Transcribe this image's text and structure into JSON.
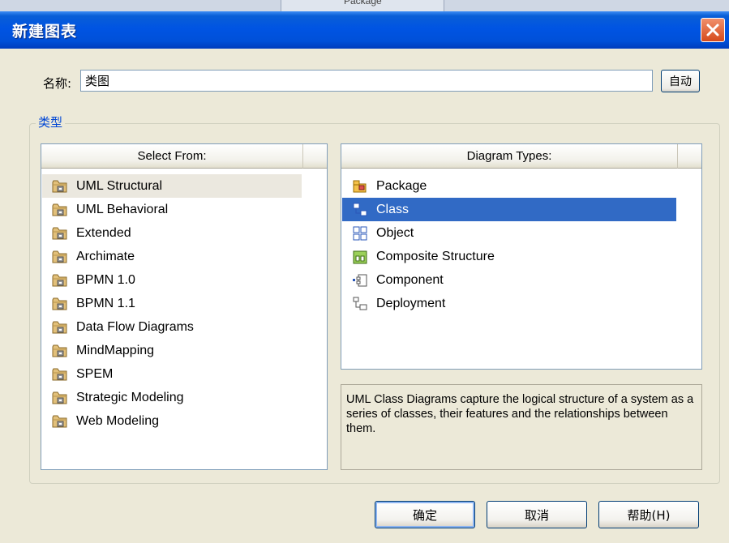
{
  "background": {
    "text": "Package"
  },
  "window": {
    "title": "新建图表",
    "close_icon": "close-icon"
  },
  "name": {
    "label": "名称:",
    "value": "类图",
    "auto_button": "自动"
  },
  "type_group": {
    "title": "类型"
  },
  "select_from": {
    "header": "Select From:",
    "selected_index": 0,
    "items": [
      {
        "label": "UML Structural"
      },
      {
        "label": "UML Behavioral"
      },
      {
        "label": "Extended"
      },
      {
        "label": "Archimate"
      },
      {
        "label": "BPMN 1.0"
      },
      {
        "label": "BPMN 1.1"
      },
      {
        "label": "Data Flow Diagrams"
      },
      {
        "label": "MindMapping"
      },
      {
        "label": "SPEM"
      },
      {
        "label": "Strategic Modeling"
      },
      {
        "label": "Web Modeling"
      }
    ]
  },
  "diagram_types": {
    "header": "Diagram Types:",
    "selected_index": 1,
    "items": [
      {
        "label": "Package",
        "icon": "package-icon"
      },
      {
        "label": "Class",
        "icon": "class-icon"
      },
      {
        "label": "Object",
        "icon": "object-icon"
      },
      {
        "label": "Composite Structure",
        "icon": "composite-structure-icon"
      },
      {
        "label": "Component",
        "icon": "component-icon"
      },
      {
        "label": "Deployment",
        "icon": "deployment-icon"
      }
    ]
  },
  "description": "UML Class Diagrams capture the logical structure of a system as a series of classes, their features and the relationships between them.",
  "buttons": {
    "ok": "确定",
    "cancel": "取消",
    "help": "帮助(H)"
  },
  "colors": {
    "titlebar": "#0054e3",
    "selection_bg": "#316ac5",
    "selection_light": "#ebe8df",
    "group_title": "#0046d5"
  }
}
